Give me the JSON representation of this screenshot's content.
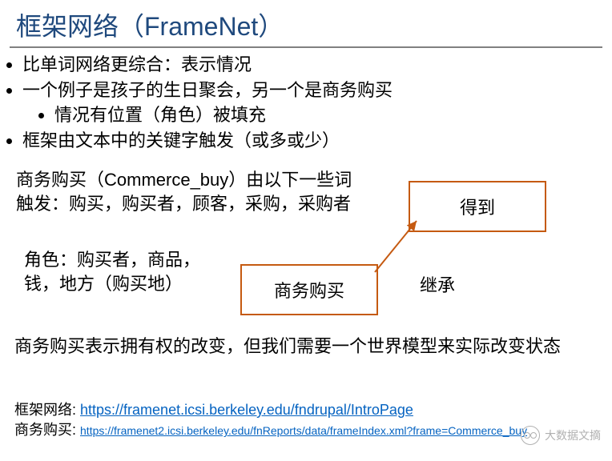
{
  "title": "框架网络（FrameNet）",
  "bullets": {
    "b1": "比单词网络更综合：表示情况",
    "b2": "一个例子是孩子的生日聚会，另一个是商务购买",
    "b2_sub": "情况有位置（角色）被填充",
    "b3": "框架由文本中的关键字触发（或多或少）"
  },
  "trigger_text": "商务购买（Commerce_buy）由以下一些词触发：购买，购买者，顾客，采购，采购者",
  "roles_text": "角色：购买者，商品，钱，地方（购买地）",
  "box_get": "得到",
  "box_buy": "商务购买",
  "inherit_label": "继承",
  "bottom_text": "商务购买表示拥有权的改变，但我们需要一个世界模型来实际改变状态",
  "footer": {
    "l1_label": "框架网络: ",
    "l1_url": "https://framenet.icsi.berkeley.edu/fndrupal/IntroPage",
    "l2_label": "商务购买: ",
    "l2_url": "https://framenet2.icsi.berkeley.edu/fnReports/data/frameIndex.xml?frame=Commerce_buy"
  },
  "watermark": "大数据文摘"
}
